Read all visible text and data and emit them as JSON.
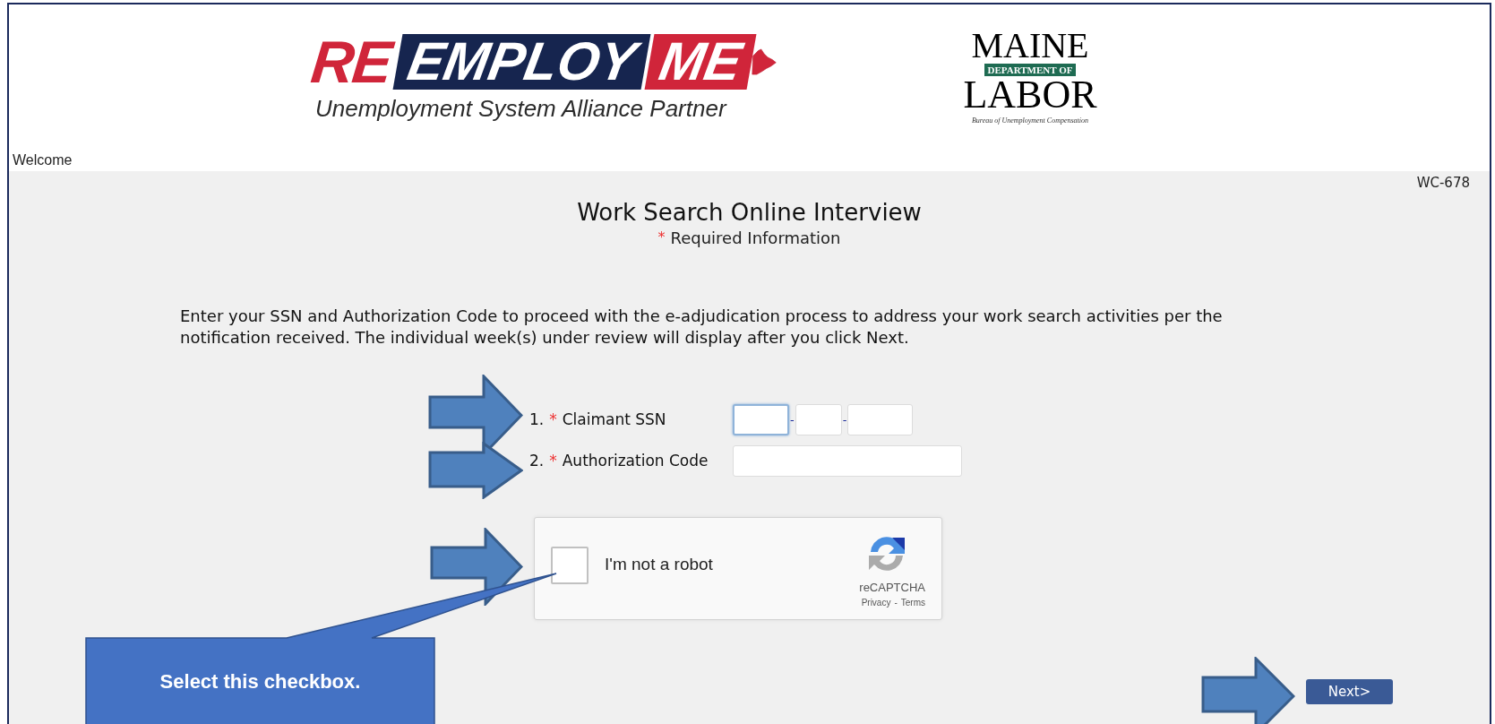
{
  "header": {
    "logo_main": {
      "parts": [
        {
          "text": "RE",
          "kind": "plain"
        },
        {
          "text": "EMPLOY",
          "kind": "band"
        },
        {
          "text": "ME",
          "kind": "block"
        }
      ],
      "tagline": "Unemployment System Alliance Partner"
    },
    "logo_agency": {
      "top": "MAINE",
      "band": "DEPARTMENT OF",
      "bottom": "LABOR",
      "caption": "Bureau of Unemployment Compensation"
    },
    "welcome": "Welcome"
  },
  "form_code": "WC-678",
  "title": "Work Search Online Interview",
  "required_note": {
    "marker": "*",
    "text": "Required Information"
  },
  "instructions": "Enter your SSN and Authorization Code to proceed with the e-adjudication process to address your work search activities per the notification received. The individual week(s) under review will display after you click Next.",
  "fields": [
    {
      "number": "1.",
      "marker": "*",
      "label": "Claimant SSN",
      "kind": "ssn",
      "separator": "-",
      "segments": [
        {
          "focused": true
        },
        {
          "focused": false
        },
        {
          "focused": false
        }
      ]
    },
    {
      "number": "2.",
      "marker": "*",
      "label": "Authorization Code",
      "kind": "text",
      "focused": false
    }
  ],
  "captcha": {
    "label": "I'm not a robot",
    "checked": false,
    "brand": "reCAPTCHA",
    "links": [
      "Privacy",
      "Terms"
    ],
    "separator": "-"
  },
  "next_button": "Next>",
  "annotation": {
    "callout": "Select this checkbox."
  }
}
